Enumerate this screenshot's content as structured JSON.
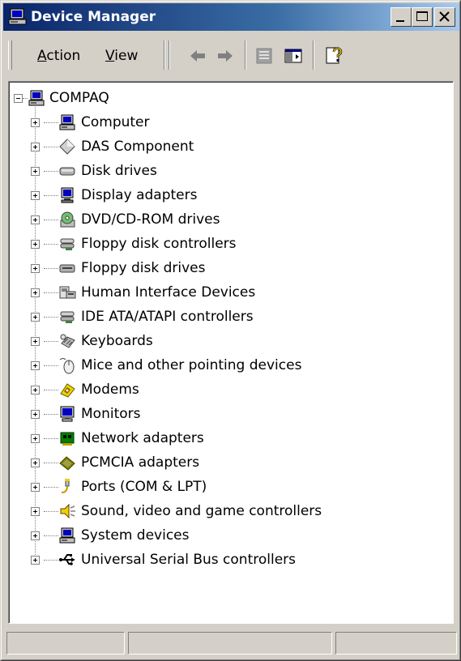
{
  "window": {
    "title": "Device Manager"
  },
  "toolbar": {
    "menu": [
      {
        "label": "Action",
        "accel": "A",
        "rest": "ction"
      },
      {
        "label": "View",
        "accel": "V",
        "rest": "iew"
      }
    ],
    "buttons": [
      "back-arrow",
      "forward-arrow",
      "properties",
      "show-hide-console-tree",
      "help"
    ]
  },
  "tree": {
    "root": {
      "label": "COMPAQ",
      "icon": "computer-icon",
      "expanded": true
    },
    "items": [
      {
        "label": "Computer",
        "icon": "computer-icon"
      },
      {
        "label": "DAS Component",
        "icon": "das-component-icon"
      },
      {
        "label": "Disk drives",
        "icon": "disk-drive-icon"
      },
      {
        "label": "Display adapters",
        "icon": "display-adapter-icon"
      },
      {
        "label": "DVD/CD-ROM drives",
        "icon": "cdrom-icon"
      },
      {
        "label": "Floppy disk controllers",
        "icon": "floppy-controller-icon"
      },
      {
        "label": "Floppy disk drives",
        "icon": "floppy-drive-icon"
      },
      {
        "label": "Human Interface Devices",
        "icon": "hid-icon"
      },
      {
        "label": "IDE ATA/ATAPI controllers",
        "icon": "ide-controller-icon"
      },
      {
        "label": "Keyboards",
        "icon": "keyboard-icon"
      },
      {
        "label": "Mice and other pointing devices",
        "icon": "mouse-icon"
      },
      {
        "label": "Modems",
        "icon": "modem-icon"
      },
      {
        "label": "Monitors",
        "icon": "monitor-icon"
      },
      {
        "label": "Network adapters",
        "icon": "network-adapter-icon"
      },
      {
        "label": "PCMCIA adapters",
        "icon": "pcmcia-icon"
      },
      {
        "label": "Ports (COM & LPT)",
        "icon": "port-icon"
      },
      {
        "label": "Sound, video and game controllers",
        "icon": "sound-icon"
      },
      {
        "label": "System devices",
        "icon": "system-device-icon"
      },
      {
        "label": "Universal Serial Bus controllers",
        "icon": "usb-icon"
      }
    ]
  },
  "colors": {
    "titlebar_start": "#0a246a",
    "titlebar_end": "#a6caf0",
    "face": "#d4d0c8"
  }
}
